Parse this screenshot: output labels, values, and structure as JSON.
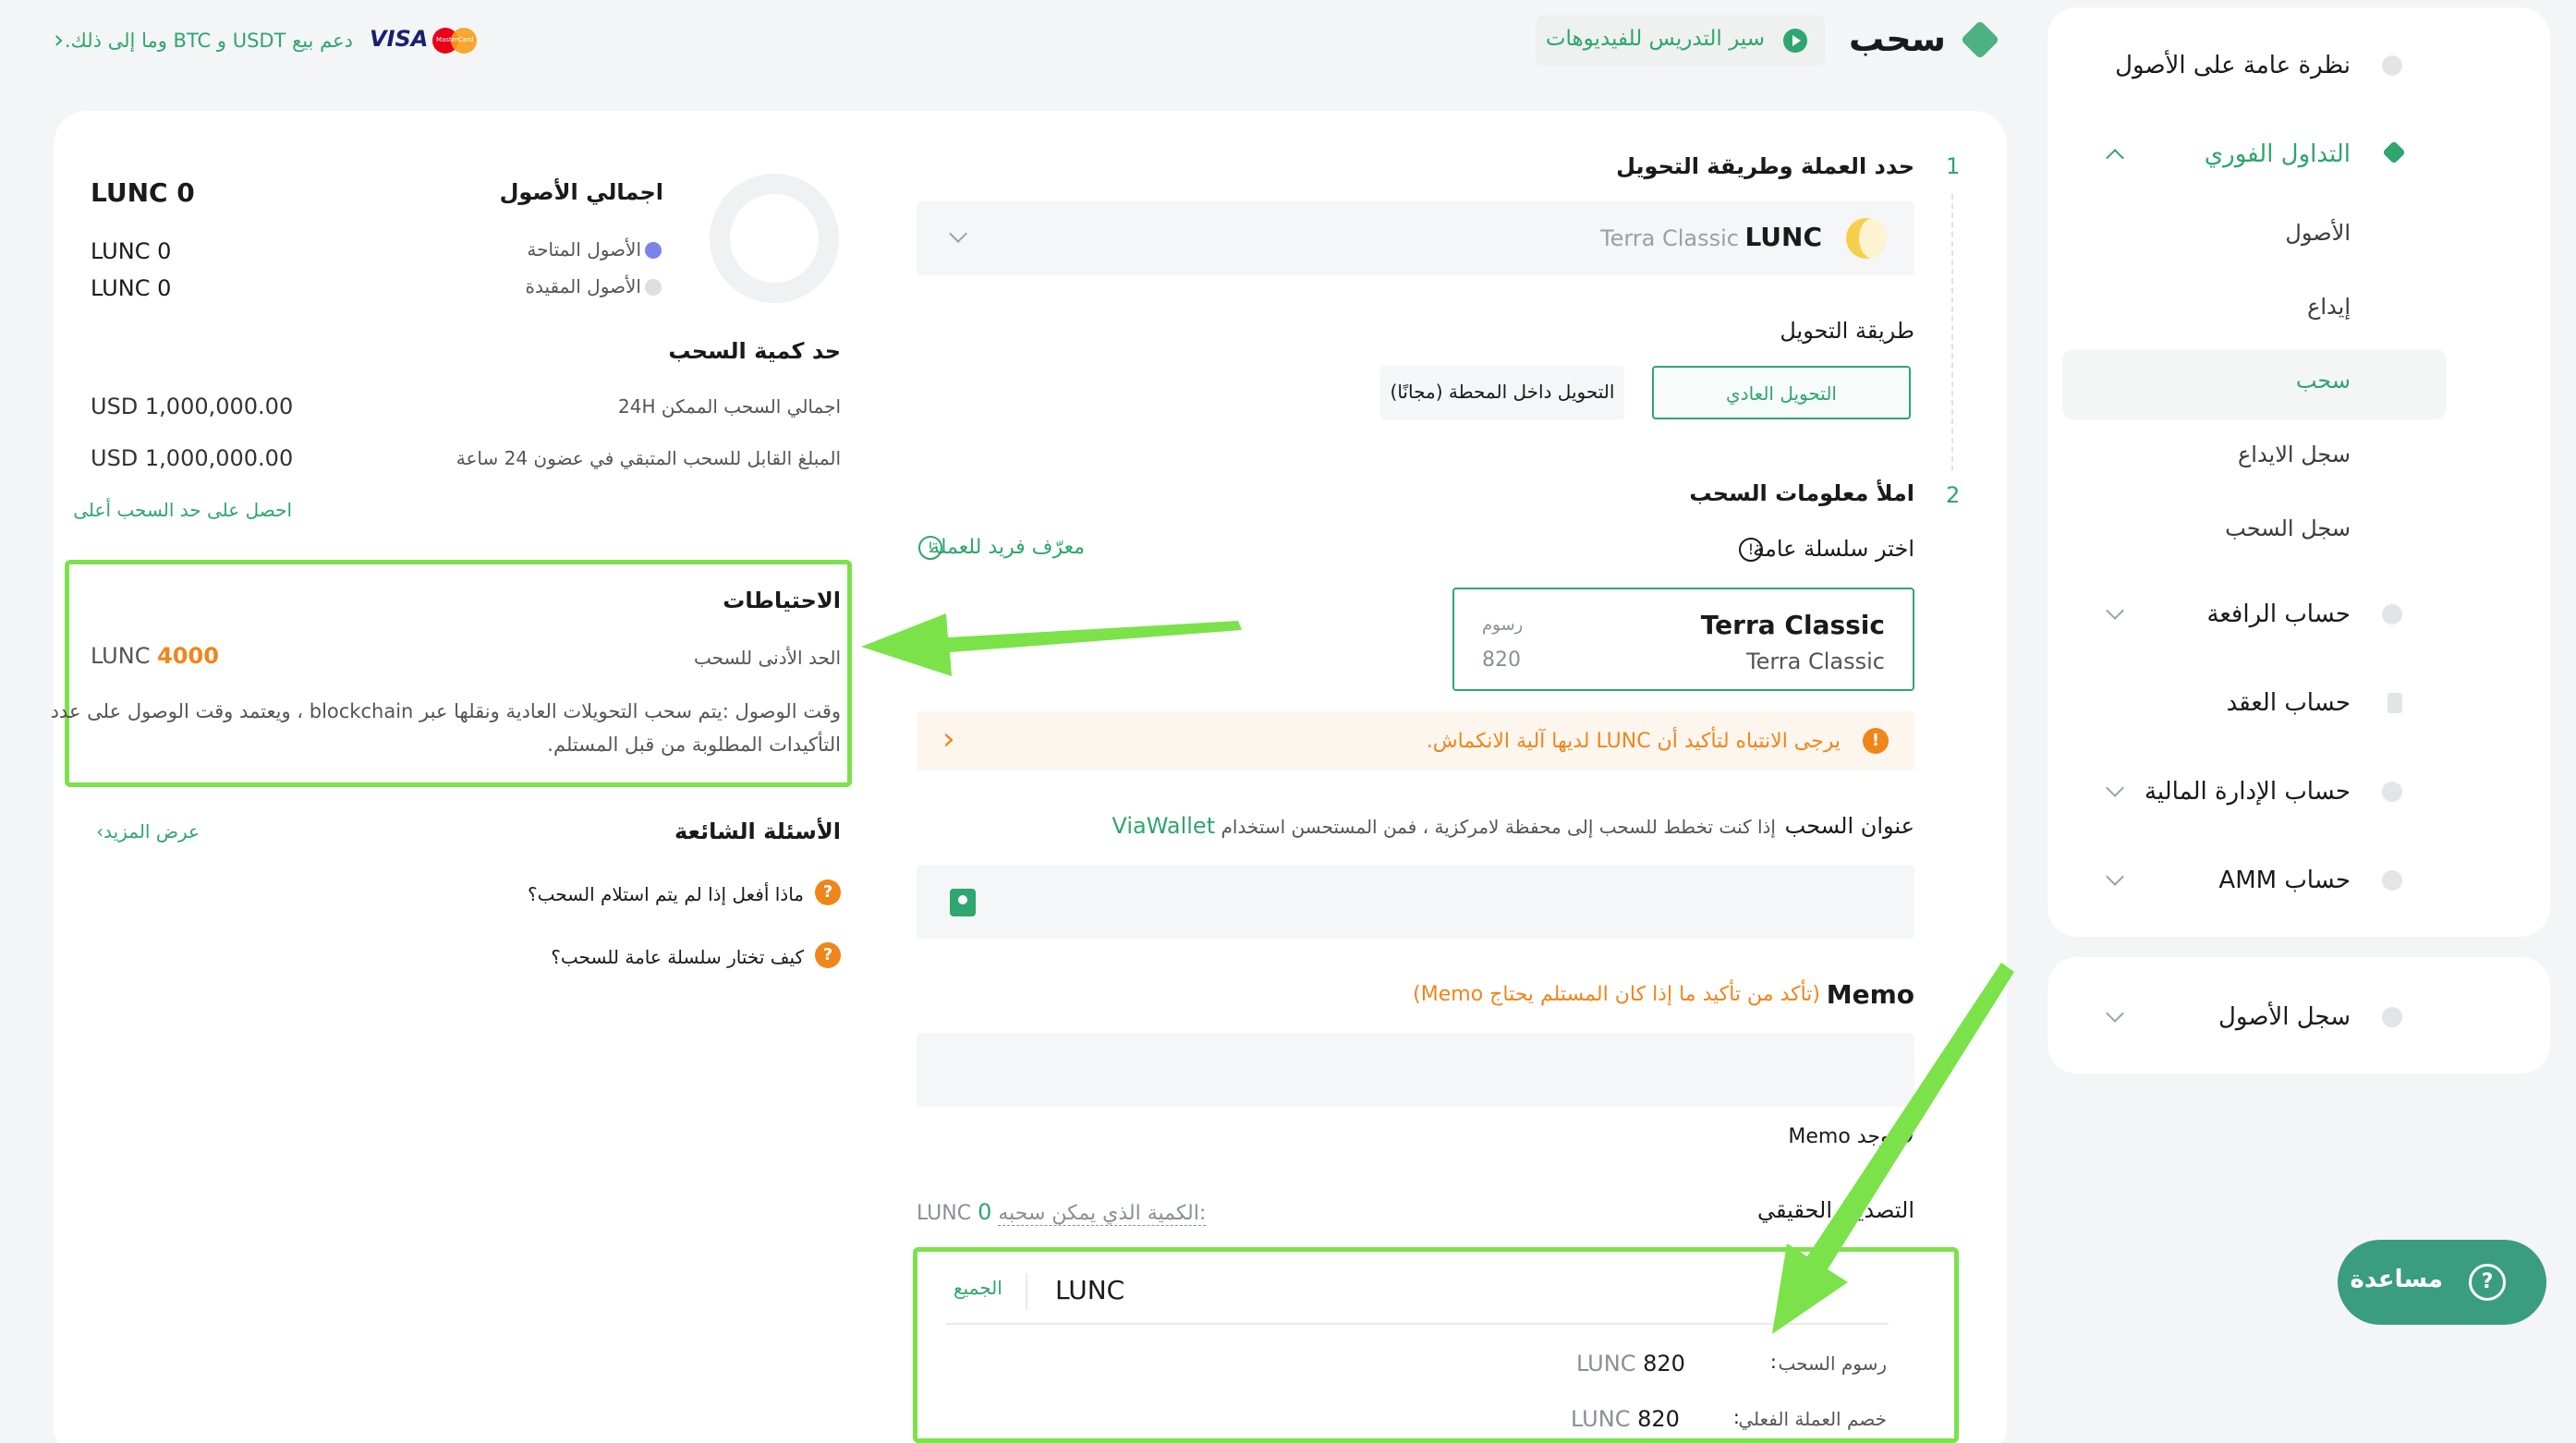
{
  "header": {
    "page_title": "سحب",
    "video_button": "سير التدريس للفيديوهات",
    "support_text": "دعم بيع USDT و BTC وما إلى ذلك.",
    "visa_label": "VISA",
    "mastercard_label": "MasterCard",
    "support_arrow": "›"
  },
  "sidebar": {
    "items": [
      {
        "label": "نظرة عامة على الأصول"
      },
      {
        "label": "التداول الفوري"
      },
      {
        "label": "الأصول"
      },
      {
        "label": "إيداع"
      },
      {
        "label": "سحب"
      },
      {
        "label": "سجل الايداع"
      },
      {
        "label": "سجل السحب"
      },
      {
        "label": "حساب الرافعة"
      },
      {
        "label": "حساب العقد"
      },
      {
        "label": "حساب الإدارة المالية"
      },
      {
        "label": "حساب AMM"
      }
    ],
    "records": "سجل الأصول"
  },
  "form": {
    "step1_num": "1",
    "step1_title": "حدد العملة وطريقة التحويل",
    "coin_symbol": "LUNC",
    "coin_name": "Terra Classic",
    "method_label": "طريقة التحويل",
    "method_normal": "التحويل العادي",
    "method_internal": "التحويل داخل المحطة (مجانًا)",
    "step2_num": "2",
    "step2_title": "املأ معلومات السحب",
    "chain_label": "اختر سلسلة عامة",
    "coin_id_label": "معرّف فريد للعملة",
    "chain_name": "Terra Classic",
    "chain_sub": "Terra Classic",
    "chain_fee_label": "رسوم",
    "chain_fee_value": "820",
    "warning": "يرجى الانتباه لتأكيد أن LUNC لديها آلية الانكماش.",
    "warning_arrow": "›",
    "address_label": "عنوان السحب",
    "address_hint": "إذا كنت تخطط للسحب إلى محفظة لامركزية ، فمن المستحسن استخدام",
    "address_wallet": "ViaWallet",
    "memo_label": "Memo",
    "memo_hint": "(تأكد من تأكيد ما إذا كان المستلم يحتاج Memo)",
    "no_memo": "لا يوجد Memo",
    "verify_label": "التصديق الحقيقي",
    "available_label": "الكمية الذي يمكن سحبه:",
    "available_value": "0",
    "available_unit": "LUNC",
    "amount_unit": "LUNC",
    "all_label": "الجميع",
    "fee_label": "رسوم السحب",
    "fee_value": "820",
    "fee_unit": "LUNC",
    "deduct_label": "خصم العملة الفعلي",
    "deduct_value": "820",
    "deduct_unit": "LUNC",
    "colon": ":"
  },
  "assets": {
    "title": "اجمالي الأصول",
    "total": "LUNC 0",
    "available_label": "الأصول المتاحة",
    "available_value": "LUNC 0",
    "frozen_label": "الأصول المقيدة",
    "frozen_value": "LUNC 0",
    "limit_title": "حد كمية السحب",
    "limit24_label": "اجمالي السحب الممكن 24H",
    "limit24_value": "USD 1,000,000.00",
    "remaining_label": "المبلغ القابل للسحب المتبقي في عضون 24 ساعة",
    "remaining_value": "USD 1,000,000.00",
    "higher_limit": "احصل على حد السحب أعلى"
  },
  "reserve": {
    "title": "الاحتياطات",
    "min_label": "الحد الأدنى للسحب",
    "min_value": "4000",
    "min_unit": "LUNC",
    "arrival_line1": "وقت الوصول  :يتم سحب التحويلات العادية ونقلها عبر blockchain ، ويعتمد وقت الوصول على عدد",
    "arrival_line2": "التأكيدات المطلوبة من قبل المستلم."
  },
  "faq": {
    "title": "الأسئلة الشائعة",
    "more": "عرض المزيد›",
    "q1": "ماذا أفعل إذا لم يتم استلام السحب؟",
    "q2": "كيف تختار سلسلة عامة للسحب؟",
    "q_icon": "?"
  },
  "help": {
    "label": "مساعدة",
    "icon": "?"
  },
  "colors": {
    "accent": "#2fa56f",
    "warning": "#f0851a",
    "highlight": "#7be24a",
    "help_button": "#3a9d7e"
  }
}
